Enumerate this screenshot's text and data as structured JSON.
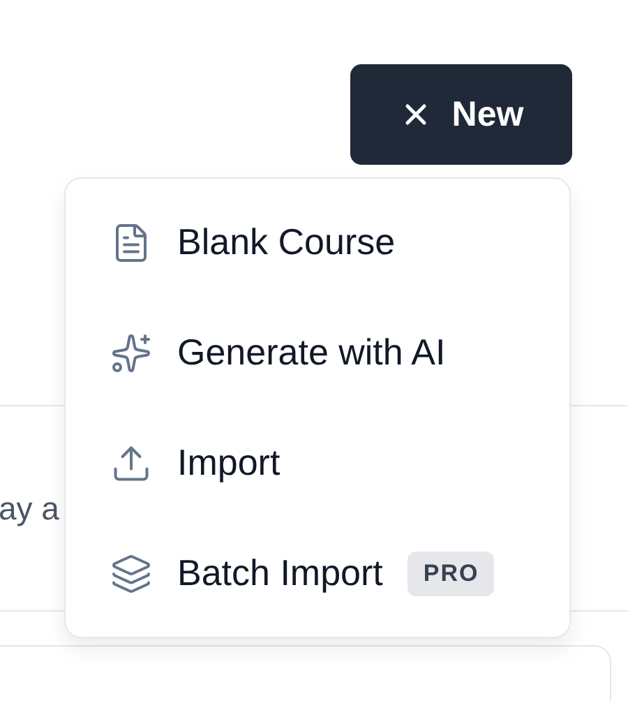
{
  "new_button": {
    "label": "New",
    "open": true
  },
  "menu": {
    "items": [
      {
        "label": "Blank Course"
      },
      {
        "label": "Generate with AI"
      },
      {
        "label": "Import"
      },
      {
        "label": "Batch Import",
        "badge": "PRO"
      }
    ]
  },
  "background_card": {
    "text": "ay a"
  }
}
